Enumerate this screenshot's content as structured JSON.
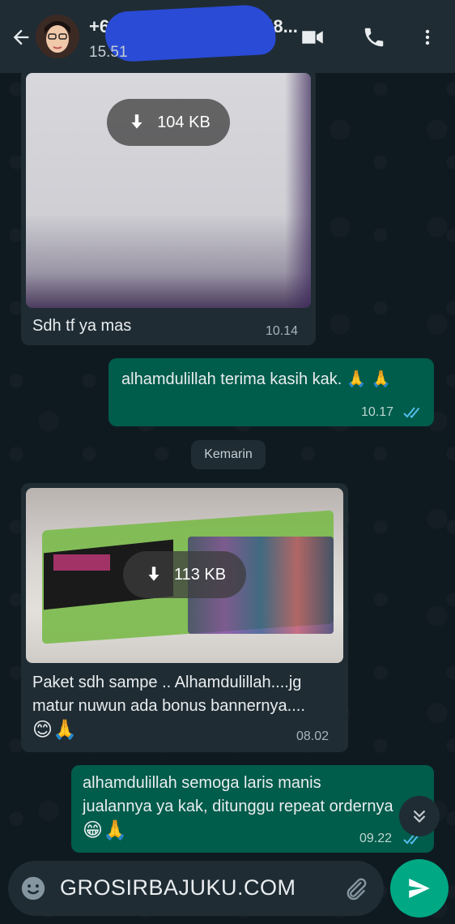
{
  "header": {
    "name": "+6",
    "name_suffix": "48...",
    "status": "15.51"
  },
  "messages": [
    {
      "direction": "in",
      "media_size": "104 KB",
      "caption": "Sdh tf ya mas",
      "time": "10.14"
    },
    {
      "direction": "out",
      "text": "alhamdulillah terima kasih kak. 🙏 🙏",
      "time": "10.17"
    },
    {
      "direction": "in",
      "media_size": "113 KB",
      "caption_line1": "Paket sdh sampe .. Alhamdulillah....jg",
      "caption_line2": "matur nuwun ada bonus bannernya....",
      "caption_line3": "😊🙏",
      "time": "08.02"
    },
    {
      "direction": "out",
      "text_line1": "alhamdulillah semoga laris manis",
      "text_line2": "jualannya ya kak, ditunggu repeat ordernya",
      "text_line3": "😁🙏",
      "time": "09.22"
    }
  ],
  "date_divider": "Kemarin",
  "composer": {
    "value": "GROSIRBAJUKU.COM"
  },
  "colors": {
    "header": "#1f2c34",
    "incoming": "#1f2c34",
    "outgoing": "#005c4b",
    "accent": "#00a884",
    "read_ticks": "#53bdeb"
  },
  "icons": [
    "back-arrow-icon",
    "video-call-icon",
    "phone-icon",
    "more-icon",
    "download-icon",
    "double-check-icon",
    "chevron-double-down-icon",
    "emoji-icon",
    "paperclip-icon",
    "send-icon"
  ]
}
